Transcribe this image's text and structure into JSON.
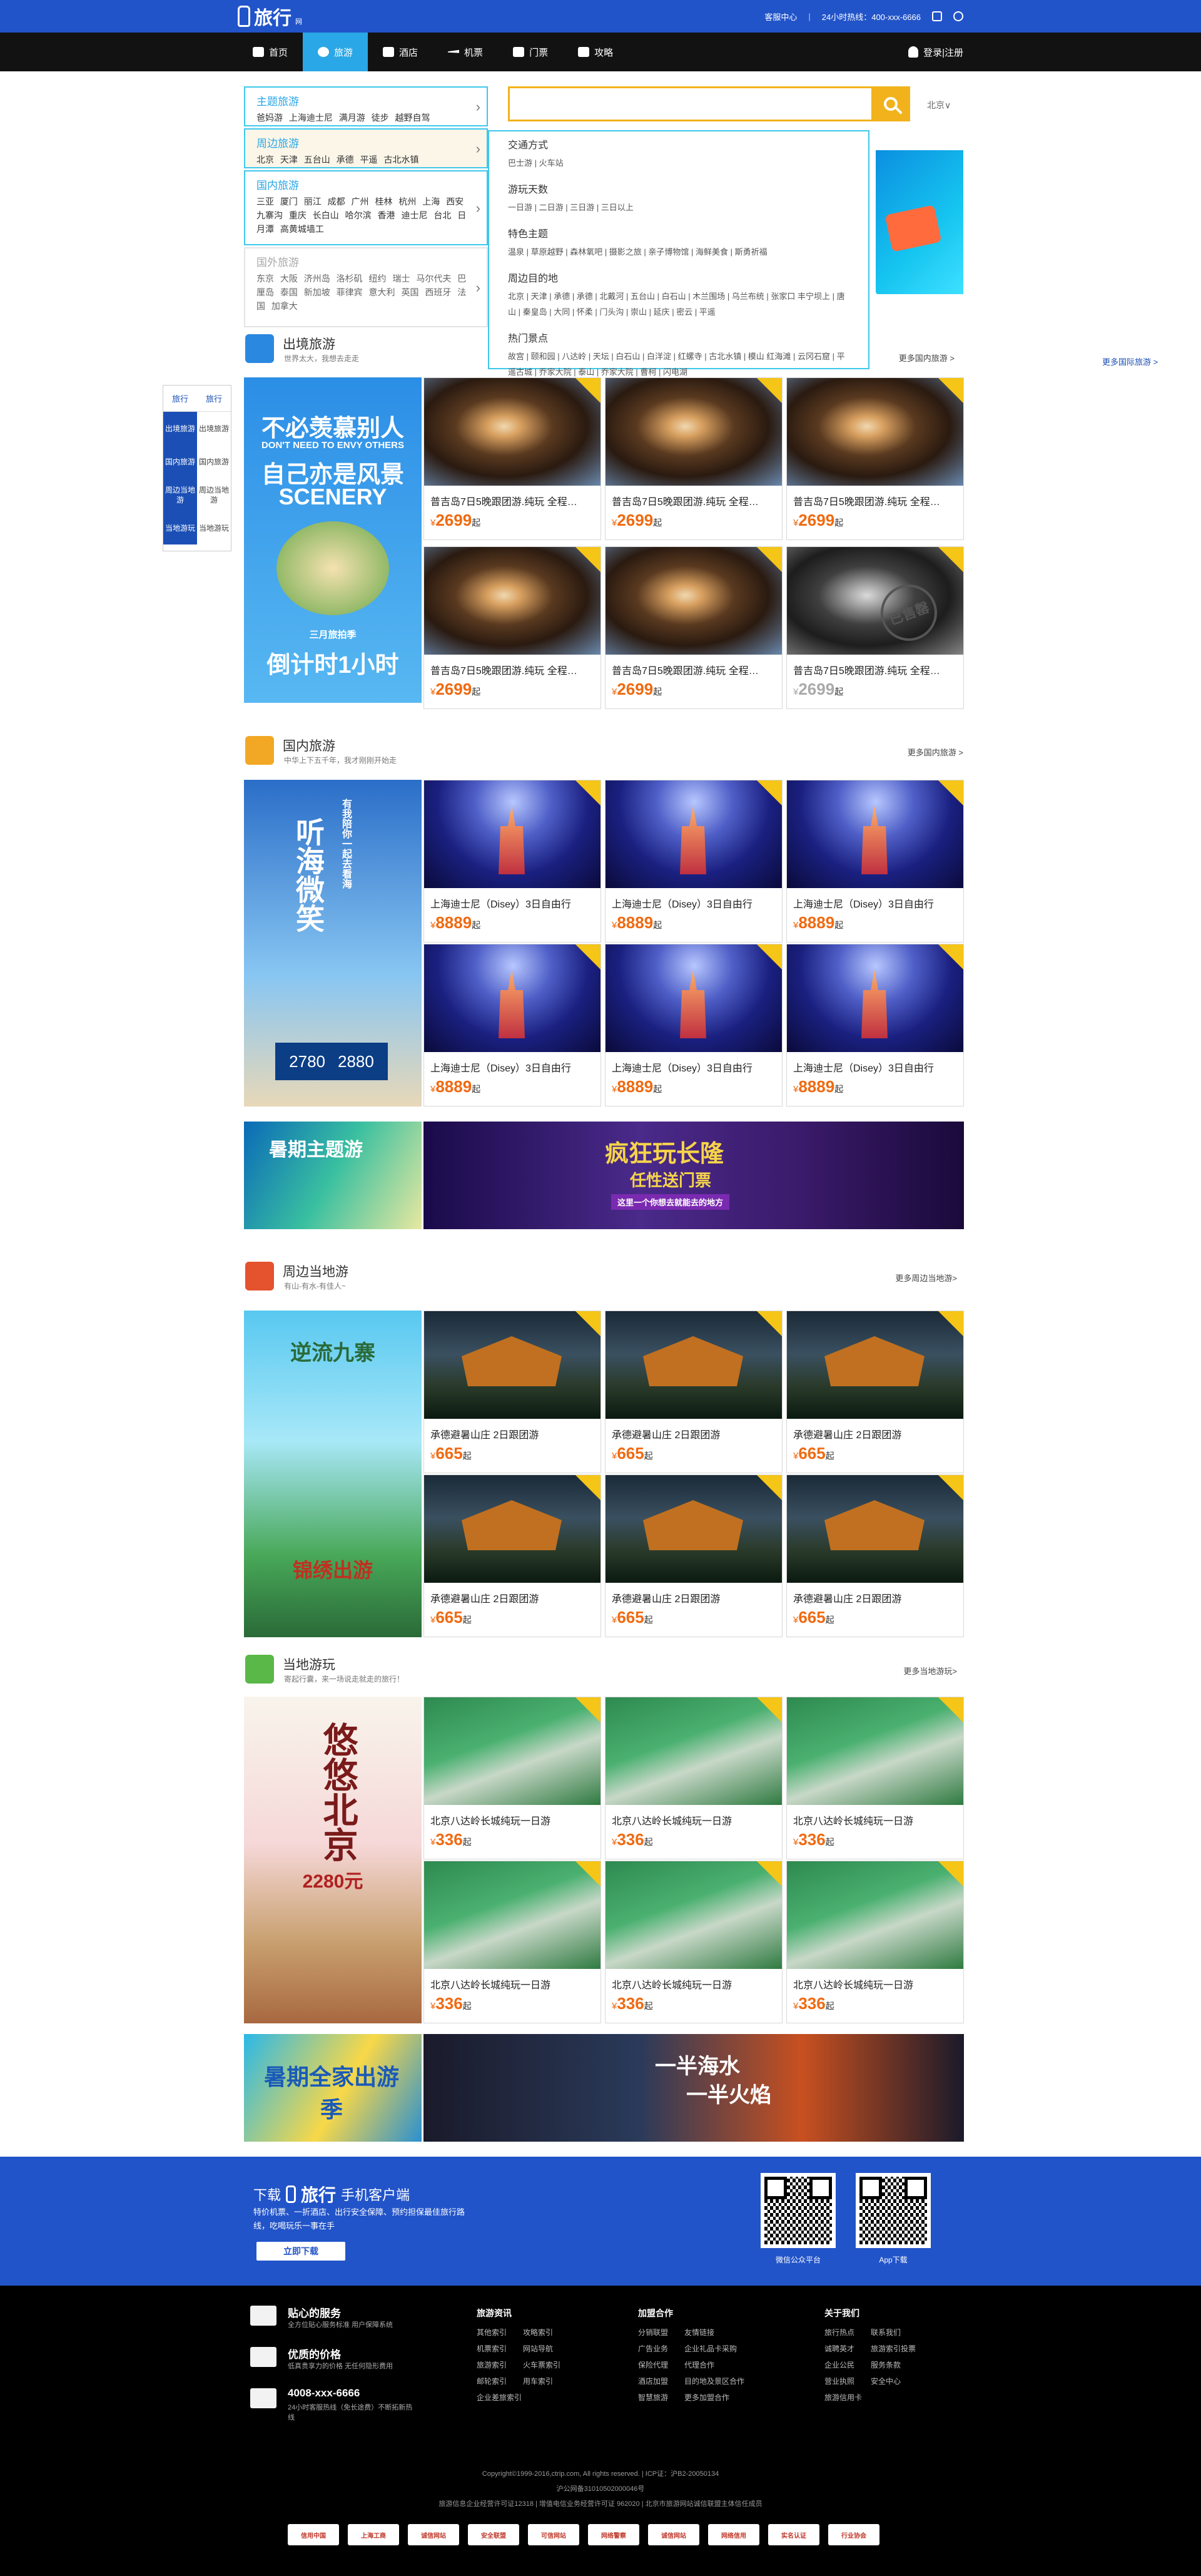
{
  "header": {
    "logo_text": "旅行",
    "logo_sub": "网",
    "service_center": "客服中心",
    "separator": "|",
    "hotline": "24小时热线：400-xxx-6666"
  },
  "nav": {
    "items": [
      {
        "label": "首页",
        "icon": "home-icon"
      },
      {
        "label": "旅游",
        "icon": "globe-icon"
      },
      {
        "label": "酒店",
        "icon": "hotel-icon"
      },
      {
        "label": "机票",
        "icon": "airplane-icon"
      },
      {
        "label": "门票",
        "icon": "ticket-icon"
      },
      {
        "label": "攻略",
        "icon": "book-icon"
      }
    ],
    "login": "登录|注册"
  },
  "categories": [
    {
      "title": "主题旅游",
      "links": "爸妈游 上海迪士尼 满月游 徒步 越野自驾"
    },
    {
      "title": "周边旅游",
      "links": "北京 天津 五台山 承德 平遥 古北水镇"
    },
    {
      "title": "国内旅游",
      "links": "三亚 厦门 丽江 成都 广州 桂林 杭州 上海 西安 九寨沟 重庆 长白山 哈尔滨 香港 迪士尼 台北 日月潭 高黄城墙工"
    },
    {
      "title": "国外旅游",
      "links": "东京 大阪 济州岛 洛杉矶 纽约 瑞士 马尔代夫 巴厘岛 泰国 新加坡 菲律宾 意大利 英国 西班牙 法国 加拿大"
    }
  ],
  "search": {
    "placeholder": "",
    "city": "北京∨"
  },
  "dropdown": [
    {
      "title": "交通方式",
      "links": "巴士游 | 火车站"
    },
    {
      "title": "游玩天数",
      "links": "一日游 | 二日游 | 三日游 | 三日以上"
    },
    {
      "title": "特色主题",
      "links": "温泉 | 草原越野 | 森林氧吧 | 摄影之旅 | 亲子博物馆 | 海鲜美食 | 斯勇祈福"
    },
    {
      "title": "周边目的地",
      "links": "北京 | 天津 | 承德 | 承德 | 北戴河 | 五台山 | 白石山 | 木兰围场 | 乌兰布统 | 张家口 丰宁坝上 | 唐山 | 秦皇岛 | 大同 | 怀柔 | 门头沟 | 崇山 | 延庆 | 密云 | 平遥"
    },
    {
      "title": "热门景点",
      "links": "故宫 | 颐和园 | 八达岭 | 天坛 | 白石山 | 白洋淀 | 红螺寺 | 古北水镇 | 模山 红海滩 | 云冈石窟 | 平遥古城 | 乔家大院 | 泰山 | 乔家大院 | 曹柯 | 闪电湖"
    }
  ],
  "sidetabs": {
    "heads": [
      "旅行",
      "旅行"
    ],
    "rows": [
      [
        "出境旅游",
        "出境旅游"
      ],
      [
        "国内旅游",
        "国内旅游"
      ],
      [
        "周边当地游",
        "周边当地游"
      ],
      [
        "当地游玩",
        "当地游玩"
      ]
    ]
  },
  "sections": {
    "outbound": {
      "title": "出境旅游",
      "sub": "世界太大，我想去走走",
      "more": "更多国内旅游 >",
      "more2": "更多国际旅游 >"
    },
    "domestic": {
      "title": "国内旅游",
      "sub": "中华上下五千年，我才刚刚开始走",
      "more": "更多国内旅游 >"
    },
    "nearby": {
      "title": "周边当地游",
      "sub": "有山-有水-有佳人~",
      "more": "更多周边当地游>"
    },
    "local": {
      "title": "当地游玩",
      "sub": "寄起行囊，来一场说走就走的旅行！",
      "more": "更多当地游玩>"
    }
  },
  "promos": {
    "outbound": {
      "line1": "不必羡慕别人",
      "line2": "DON'T NEED TO ENVY OTHERS",
      "line3": "自己亦是风景",
      "line4": "SCENERY",
      "line5": "三月旅拍季",
      "line6": "倒计时1小时"
    },
    "domestic": {
      "line1": "听海微笑",
      "line2": "有我陪你一起去看海",
      "price1": "2780",
      "price2": "2880"
    },
    "nearby": {
      "line1": "逆流九寨",
      "line2": "锦绣出游"
    },
    "local": {
      "line1": "悠悠北京",
      "price": "2280元"
    }
  },
  "cards": {
    "outbound": [
      {
        "title": "普吉岛7日5晚跟团游.纯玩 全程…",
        "price": "2699",
        "unit": "起"
      },
      {
        "title": "普吉岛7日5晚跟团游.纯玩 全程…",
        "price": "2699",
        "unit": "起"
      },
      {
        "title": "普吉岛7日5晚跟团游.纯玩 全程…",
        "price": "2699",
        "unit": "起"
      },
      {
        "title": "普吉岛7日5晚跟团游.纯玩 全程…",
        "price": "2699",
        "unit": "起"
      },
      {
        "title": "普吉岛7日5晚跟团游.纯玩 全程…",
        "price": "2699",
        "unit": "起"
      },
      {
        "title": "普吉岛7日5晚跟团游.纯玩 全程…",
        "price": "2699",
        "unit": "起",
        "stamp": "已售罄"
      }
    ],
    "domestic": [
      {
        "title": "上海迪士尼（Disey）3日自由行",
        "price": "8889",
        "unit": "起"
      },
      {
        "title": "上海迪士尼（Disey）3日自由行",
        "price": "8889",
        "unit": "起"
      },
      {
        "title": "上海迪士尼（Disey）3日自由行",
        "price": "8889",
        "unit": "起"
      },
      {
        "title": "上海迪士尼（Disey）3日自由行",
        "price": "8889",
        "unit": "起"
      },
      {
        "title": "上海迪士尼（Disey）3日自由行",
        "price": "8889",
        "unit": "起"
      },
      {
        "title": "上海迪士尼（Disey）3日自由行",
        "price": "8889",
        "unit": "起"
      }
    ],
    "nearby": [
      {
        "title": "承德避暑山庄 2日跟团游",
        "price": "665",
        "unit": "起"
      },
      {
        "title": "承德避暑山庄 2日跟团游",
        "price": "665",
        "unit": "起"
      },
      {
        "title": "承德避暑山庄 2日跟团游",
        "price": "665",
        "unit": "起"
      },
      {
        "title": "承德避暑山庄 2日跟团游",
        "price": "665",
        "unit": "起"
      },
      {
        "title": "承德避暑山庄 2日跟团游",
        "price": "665",
        "unit": "起"
      },
      {
        "title": "承德避暑山庄 2日跟团游",
        "price": "665",
        "unit": "起"
      }
    ],
    "local": [
      {
        "title": "北京八达岭长城纯玩一日游",
        "price": "336",
        "unit": "起"
      },
      {
        "title": "北京八达岭长城纯玩一日游",
        "price": "336",
        "unit": "起"
      },
      {
        "title": "北京八达岭长城纯玩一日游",
        "price": "336",
        "unit": "起"
      },
      {
        "title": "北京八达岭长城纯玩一日游",
        "price": "336",
        "unit": "起"
      },
      {
        "title": "北京八达岭长城纯玩一日游",
        "price": "336",
        "unit": "起"
      },
      {
        "title": "北京八达岭长城纯玩一日游",
        "price": "336",
        "unit": "起"
      }
    ]
  },
  "currency": "¥",
  "banners": {
    "b1": "暑期主题游",
    "b2a": "疯狂玩长隆",
    "b2b": "任性送门票",
    "b2c": "这里一个你想去就能去的地方",
    "b3": "暑期全家出游季",
    "b4a": "一半海水",
    "b4b": "一半火焰"
  },
  "app": {
    "download": "下载",
    "brand": "旅行",
    "client": "手机客户端",
    "desc": "特价机票、一折酒店、出行安全保障、预约担保最佳旅行路线，吃喝玩乐一事在手",
    "button": "立即下载",
    "qr1": "微信公众平台",
    "qr2": "App下载"
  },
  "footer": {
    "services": [
      {
        "title": "贴心的服务",
        "desc": "全方位贴心服务标准 用户保障系统"
      },
      {
        "title": "优质的价格",
        "desc": "低真贵享力的价格 无任何隐形费用"
      },
      {
        "title": "4008-xxx-6666",
        "desc": "24小时客服热线（免长途费）不断拓新热线"
      }
    ],
    "cols": [
      {
        "head": "旅游资讯",
        "links": [
          "其他索引",
          "攻略索引",
          "机票索引",
          "网站导航",
          "旅游索引",
          "火车票索引",
          "邮轮索引",
          "用车索引",
          "企业差旅索引",
          ""
        ]
      },
      {
        "head": "加盟合作",
        "links": [
          "分销联盟",
          "友情链接",
          "广告业务",
          "企业礼品卡采购",
          "保险代理",
          "代理合作",
          "酒店加盟",
          "目的地及景区合作",
          "智慧旅游",
          "更多加盟合作"
        ]
      },
      {
        "head": "关于我们",
        "links": [
          "旅行热点",
          "联系我们",
          "诚聘英才",
          "旅游索引投票",
          "企业公民",
          "服务条款",
          "营业执照",
          "安全中心",
          "旅游信用卡",
          ""
        ]
      }
    ],
    "copyright": "Copyright©1999-2016,ctrip.com, All rights reserved. | ICP证：沪B2-20050134",
    "license": "沪公网备31010502000046号",
    "legal": "旅游信息企业经营许可证12318 | 增值电信业务经营许可证 962020 | 北京市旅游网站诚信联盟主体信任成员",
    "badges": [
      "信用中国",
      "上海工商",
      "诚信网站",
      "安全联盟",
      "可信网站",
      "网络警察",
      "诚信网站",
      "网络信用",
      "实名认证",
      "行业协会"
    ]
  }
}
